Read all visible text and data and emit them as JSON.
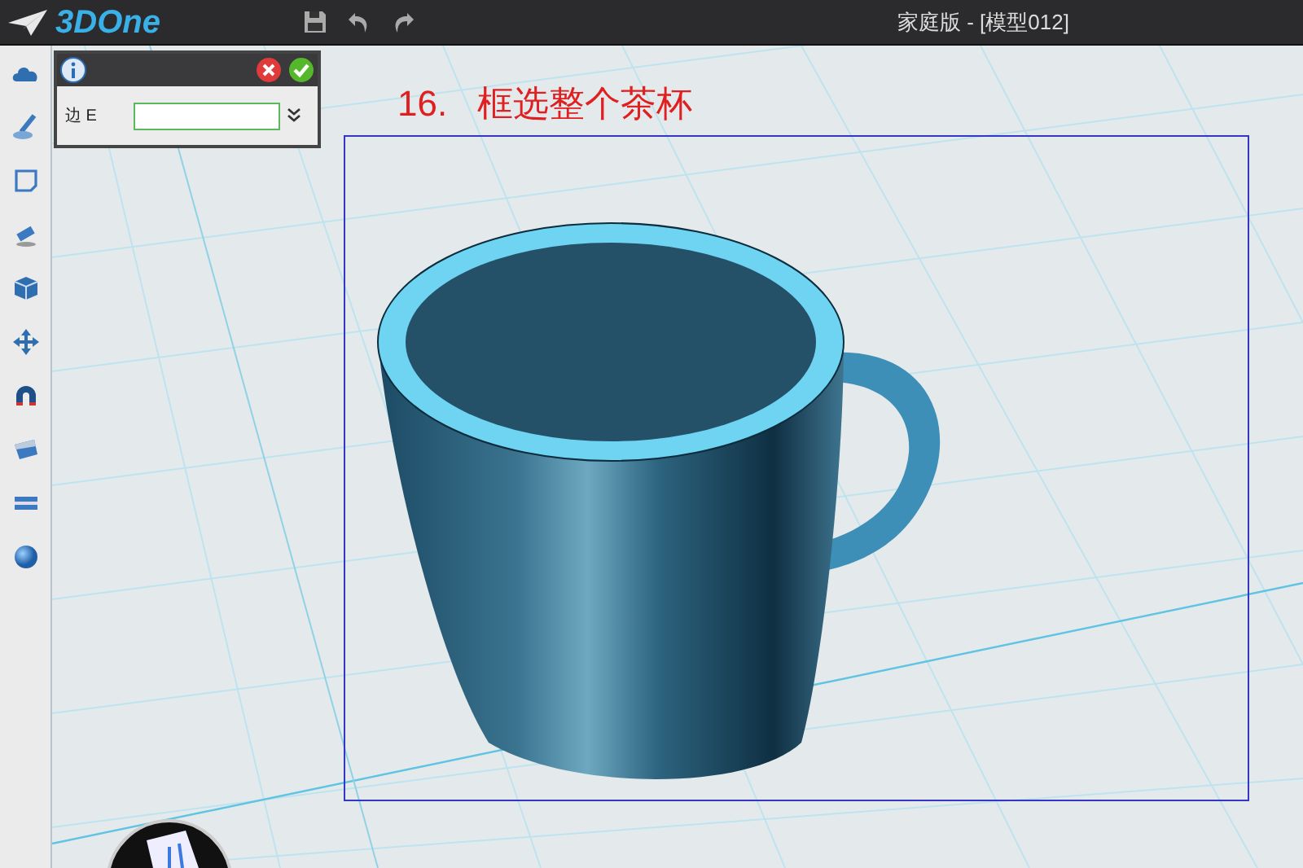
{
  "window": {
    "logo": "3DOne",
    "title": "家庭版 - [模型012]"
  },
  "dialog": {
    "field_label": "边 E"
  },
  "caption": "16.   框选整个茶杯"
}
